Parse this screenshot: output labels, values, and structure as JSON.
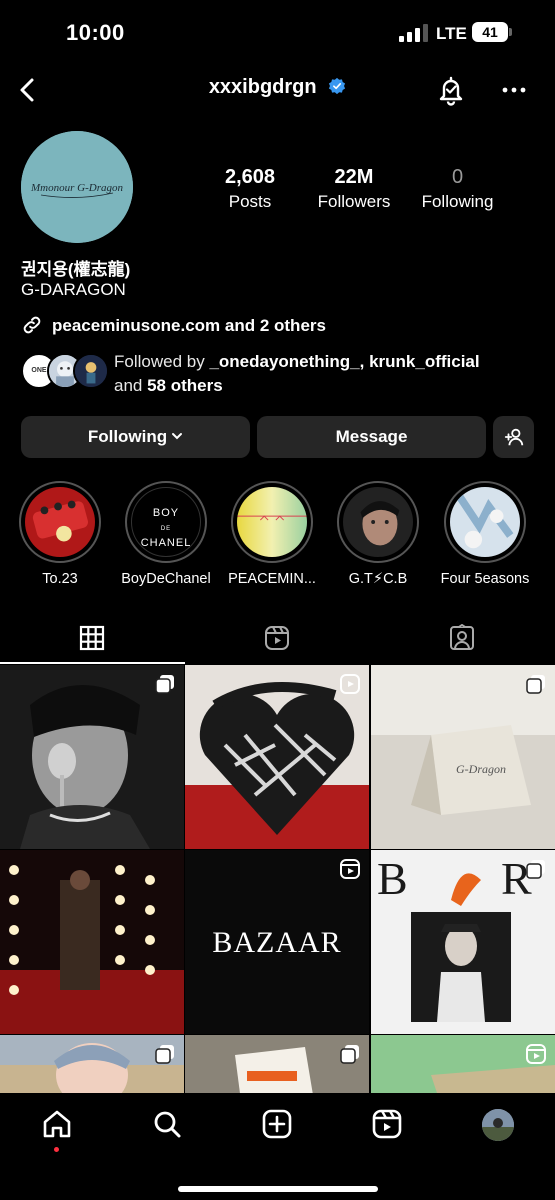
{
  "status_bar": {
    "time": "10:00",
    "network": "LTE",
    "battery": "41"
  },
  "nav": {
    "username": "xxxibgdrgn"
  },
  "profile": {
    "avatar_text": "Mmonour G-Dragon",
    "stats": [
      {
        "value": "2,608",
        "label": "Posts"
      },
      {
        "value": "22M",
        "label": "Followers"
      },
      {
        "value": "0",
        "label": "Following"
      }
    ],
    "full_name": "권지용(權志龍)",
    "category": "G-DARAGON",
    "link": "peaceminusone.com and 2 others",
    "followed_by": {
      "prefix": "Followed by ",
      "names": "_onedayonething_, krunk_official",
      "middle": " and ",
      "others": "58 others",
      "avatar1_text": "ONE"
    }
  },
  "actions": {
    "following": "Following",
    "message": "Message"
  },
  "highlights": [
    {
      "label": "To.23"
    },
    {
      "label": "BoyDeChanel",
      "inner": [
        "BOY",
        "DE",
        "CHANEL"
      ]
    },
    {
      "label": "PEACEMIN..."
    },
    {
      "label": "G.T⚡C.B"
    },
    {
      "label": "Four 5easons"
    }
  ],
  "grid": {
    "bazaar_text": "BAZAAR"
  },
  "colors": {
    "accent_verified": "#3897f0",
    "notification_dot": "#ff3040",
    "button_bg": "#262626"
  }
}
